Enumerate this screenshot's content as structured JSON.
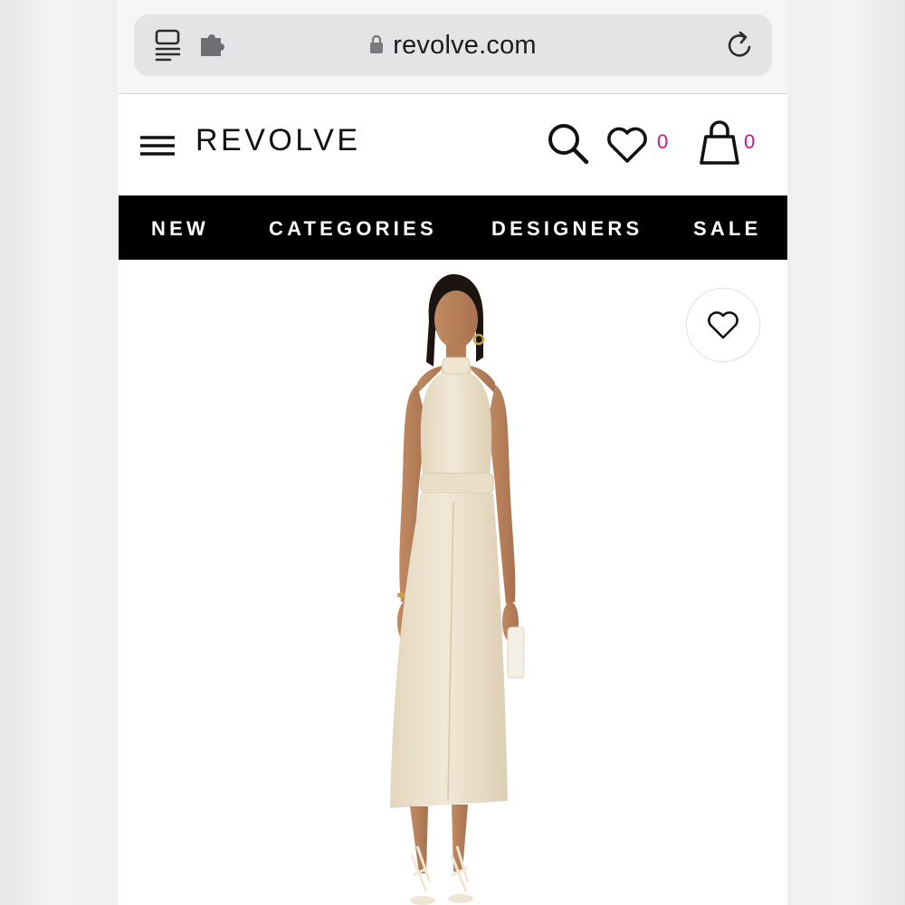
{
  "browser": {
    "url": "revolve.com",
    "icons": [
      "reader-mode-icon",
      "extension-icon",
      "lock-icon",
      "reload-icon"
    ]
  },
  "header": {
    "brand": "REVOLVE",
    "wishlist_count": "0",
    "bag_count": "0",
    "icons": [
      "menu-icon",
      "search-icon",
      "heart-icon",
      "shopping-bag-icon"
    ],
    "count_color": "#d4147e"
  },
  "nav": {
    "items": [
      {
        "label": "NEW"
      },
      {
        "label": "CATEGORIES"
      },
      {
        "label": "DESIGNERS"
      },
      {
        "label": "SALE"
      }
    ],
    "background": "#000000",
    "text_color": "#ffffff"
  },
  "product": {
    "image_icon": "product-photo-model-champagne-halter-midi-dress",
    "favorite_icon": "heart-icon",
    "dress_color": "#ece1cc"
  }
}
